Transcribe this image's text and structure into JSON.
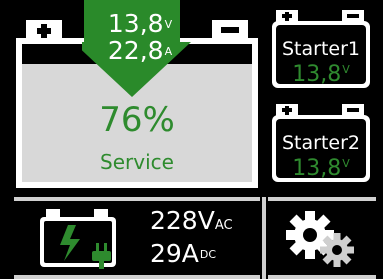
{
  "main_battery": {
    "arrow_voltage": "13,8",
    "arrow_voltage_unit": "V",
    "arrow_current": "22,8",
    "arrow_current_unit": "A",
    "percent": "76%",
    "status": "Service"
  },
  "starter1": {
    "label": "Starter1",
    "voltage": "13,8",
    "unit": "V"
  },
  "starter2": {
    "label": "Starter2",
    "voltage": "13,8",
    "unit": "V"
  },
  "charger": {
    "ac_voltage": "228V",
    "ac_unit": "AC",
    "dc_current": "29A",
    "dc_unit": "DC"
  },
  "icons": {
    "charger": "battery-plug-icon",
    "settings": "gears-icon"
  },
  "colors": {
    "accent_green": "#2e8b2e",
    "arrow_green": "#2a8a2a",
    "battery_fill": "#d8d8d8",
    "background": "#000000"
  }
}
